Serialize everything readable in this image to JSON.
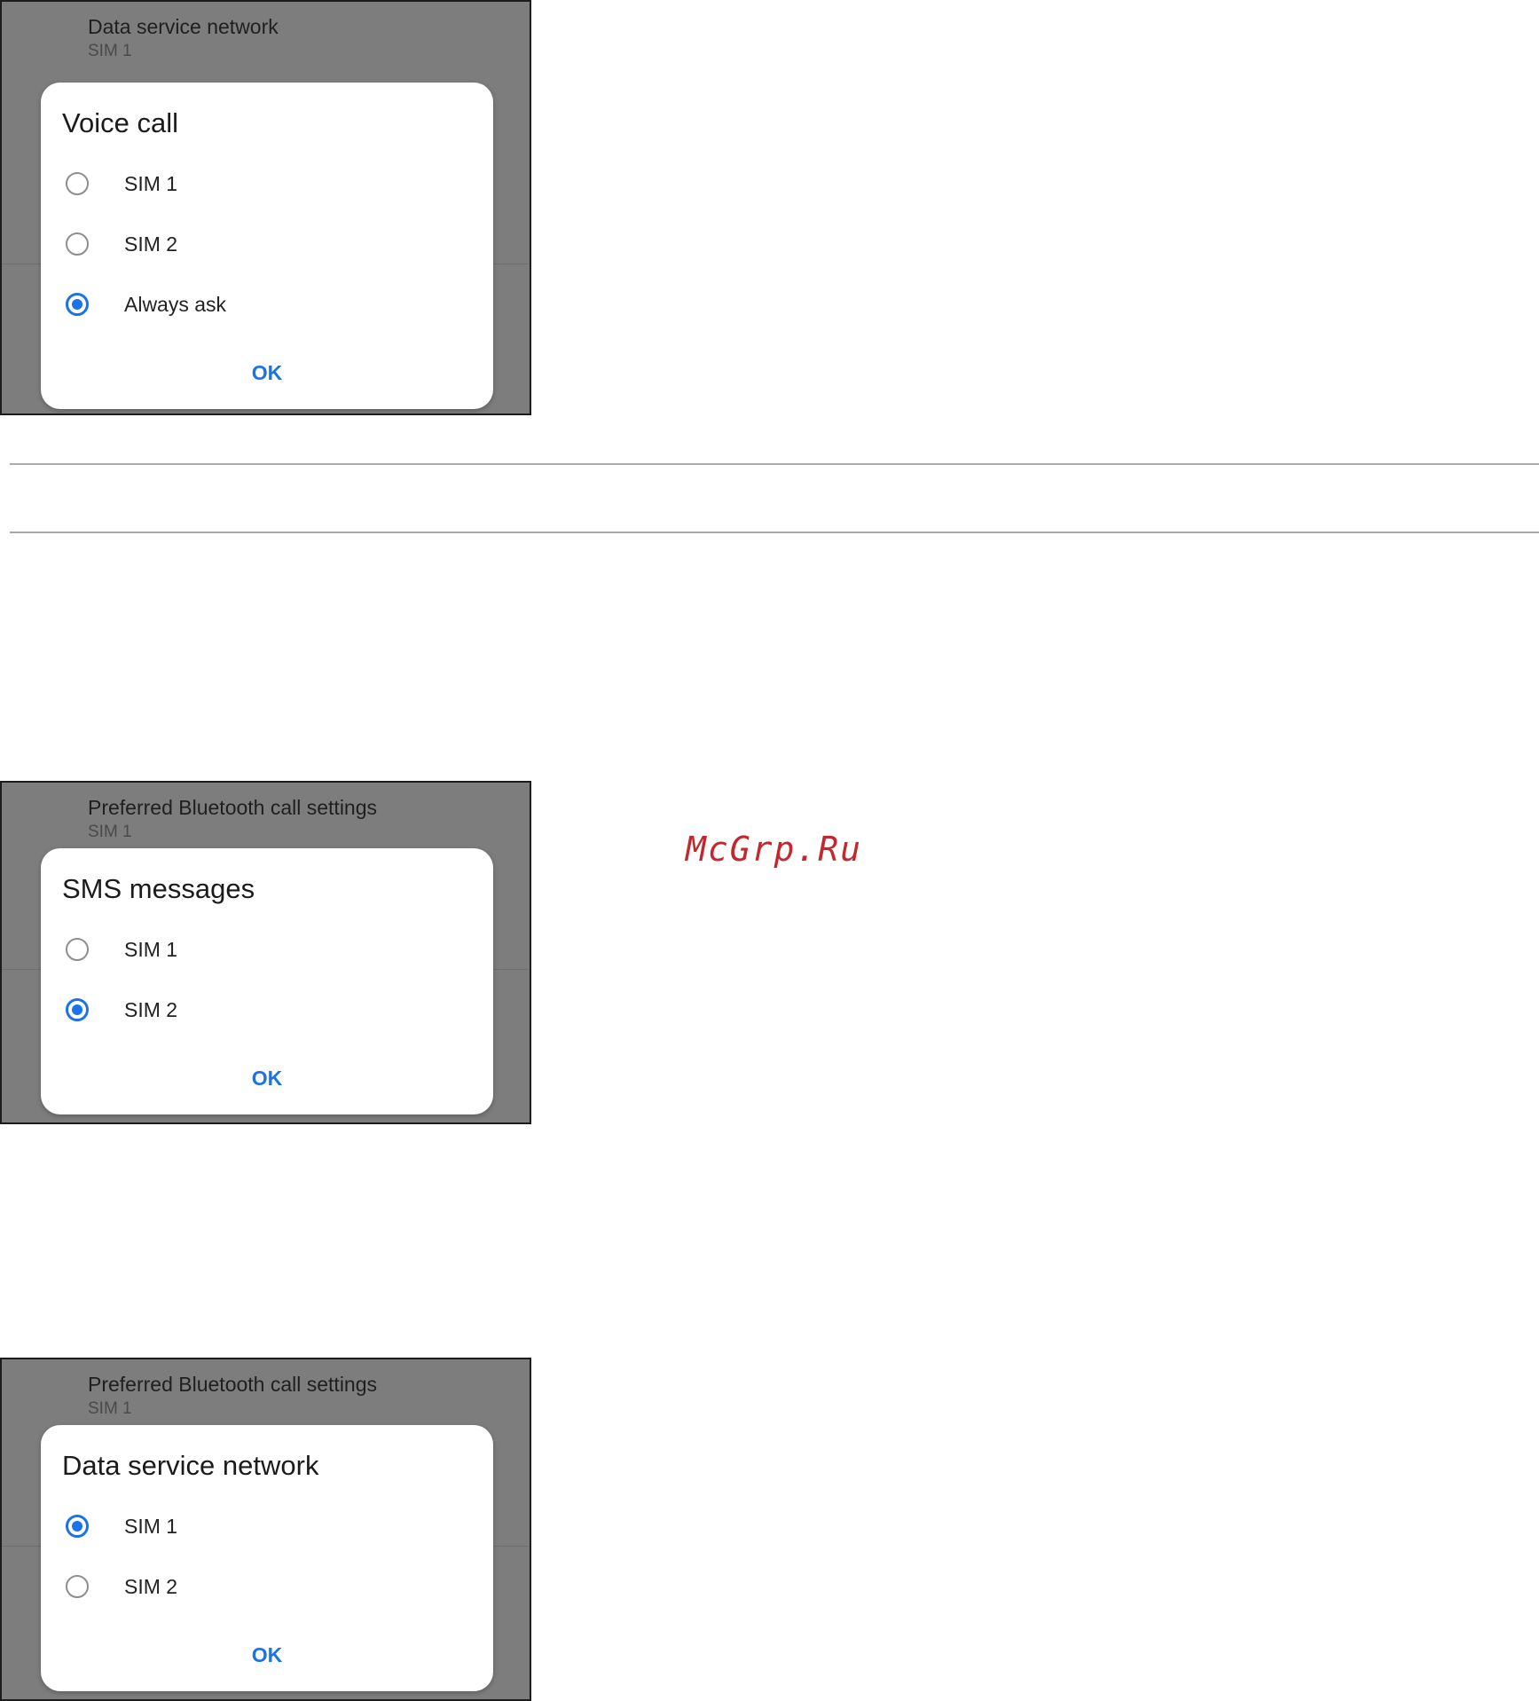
{
  "panels": [
    {
      "background_item": {
        "title": "Data service network",
        "subtitle": "SIM 1"
      },
      "dialog": {
        "title": "Voice call",
        "options": [
          {
            "label": "SIM 1",
            "checked": false
          },
          {
            "label": "SIM 2",
            "checked": false
          },
          {
            "label": "Always ask",
            "checked": true
          }
        ],
        "ok_label": "OK"
      }
    },
    {
      "background_item": {
        "title": "Preferred Bluetooth call settings",
        "subtitle": "SIM 1"
      },
      "dialog": {
        "title": "SMS messages",
        "options": [
          {
            "label": "SIM 1",
            "checked": false
          },
          {
            "label": "SIM 2",
            "checked": true
          }
        ],
        "ok_label": "OK"
      }
    },
    {
      "background_item": {
        "title": "Preferred Bluetooth call settings",
        "subtitle": "SIM 1"
      },
      "dialog": {
        "title": "Data service network",
        "options": [
          {
            "label": "SIM 1",
            "checked": true
          },
          {
            "label": "SIM 2",
            "checked": false
          }
        ],
        "ok_label": "OK"
      }
    }
  ],
  "watermark": "McGrp.Ru",
  "colors": {
    "accent": "#1a73e8",
    "scrim": "#7d7d7d",
    "watermark": "#c4282e"
  }
}
